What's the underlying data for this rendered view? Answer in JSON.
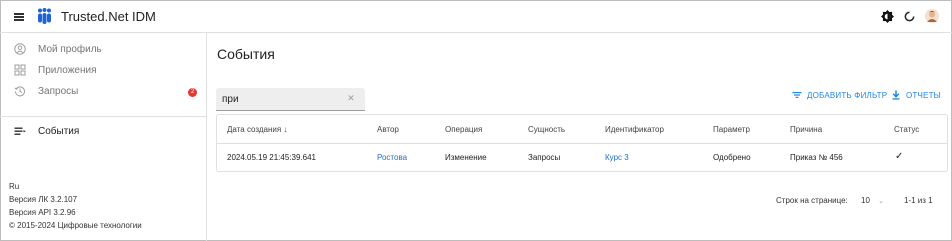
{
  "header": {
    "app_title": "Trusted.Net IDM",
    "icons": [
      "menu-icon",
      "app-logo",
      "theme-toggle-icon",
      "refresh-icon",
      "user-avatar"
    ]
  },
  "sidebar": {
    "items": [
      {
        "label": "Мой профиль",
        "icon": "person-circle-icon"
      },
      {
        "label": "Приложения",
        "icon": "apps-grid-icon"
      },
      {
        "label": "Запросы",
        "icon": "history-icon",
        "badge": "2"
      },
      {
        "label": "События",
        "icon": "events-list-icon"
      }
    ],
    "footer": {
      "lang": "Ru",
      "version_lk": "Версия ЛК 3.2.107",
      "version_api": "Версия API 3.2.96",
      "copyright": "© 2015-2024 Цифровые технологии"
    }
  },
  "main": {
    "title": "События",
    "search": {
      "value": "при",
      "placeholder": ""
    },
    "add_filter": "ДОБАВИТЬ ФИЛЬТР",
    "reports": "ОТЧЕТЫ",
    "table": {
      "columns": [
        "Дата создания",
        "Автор",
        "Операция",
        "Сущность",
        "Идентификатор",
        "Параметр",
        "Причина",
        "Статус"
      ],
      "rows": [
        [
          "2024.05.19 21:45:39.641",
          "Ростова",
          "Изменение",
          "Запросы",
          "Курс 3",
          "Одобрено",
          "Приказ № 456",
          "✓"
        ]
      ]
    },
    "pager": {
      "rows_label": "Строк на странице:",
      "rows_value": "10",
      "range": "1-1 из 1"
    }
  },
  "colors": {
    "accent": "#1e88e5",
    "badge": "#e53935"
  }
}
